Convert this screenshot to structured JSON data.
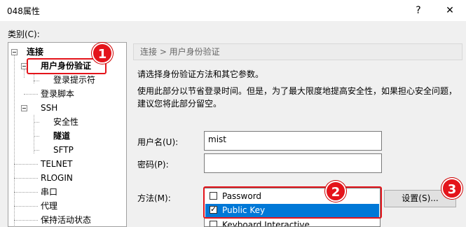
{
  "window": {
    "title": "048属性",
    "help_button": "?",
    "close_button": "✕"
  },
  "category_label": "类别(C):",
  "tree": {
    "items": [
      {
        "label": "连接",
        "bold": true
      },
      {
        "label": "用户身份验证",
        "bold": true
      },
      {
        "label": "登录提示符",
        "bold": false
      },
      {
        "label": "登录脚本",
        "bold": false
      },
      {
        "label": "SSH",
        "bold": false
      },
      {
        "label": "安全性",
        "bold": false
      },
      {
        "label": "隧道",
        "bold": true
      },
      {
        "label": "SFTP",
        "bold": false
      },
      {
        "label": "TELNET",
        "bold": false
      },
      {
        "label": "RLOGIN",
        "bold": false
      },
      {
        "label": "串口",
        "bold": false
      },
      {
        "label": "代理",
        "bold": false
      },
      {
        "label": "保持活动状态",
        "bold": false
      }
    ]
  },
  "breadcrumb": "连接 > 用户身份验证",
  "description": {
    "line1": "请选择身份验证方法和其它参数。",
    "line2": "使用此部分以节省登录时间。但是，为了最大限度地提高安全性，如果担心安全问题，",
    "line3": "建议您将此部分留空。"
  },
  "form": {
    "username_label": "用户名(U):",
    "username_value": "mist",
    "password_label": "密码(P):",
    "password_value": "",
    "method_label": "方法(M):",
    "methods": [
      {
        "label": "Password",
        "checked": false,
        "selected": false
      },
      {
        "label": "Public Key",
        "checked": true,
        "selected": true
      },
      {
        "label": "Keyboard Interactive",
        "checked": false,
        "selected": false
      }
    ],
    "settings_button": "设置(S)..."
  },
  "annotations": [
    "1",
    "2",
    "3"
  ],
  "colors": {
    "annotation_red": "#e4141b",
    "selection_blue": "#0078d7"
  }
}
